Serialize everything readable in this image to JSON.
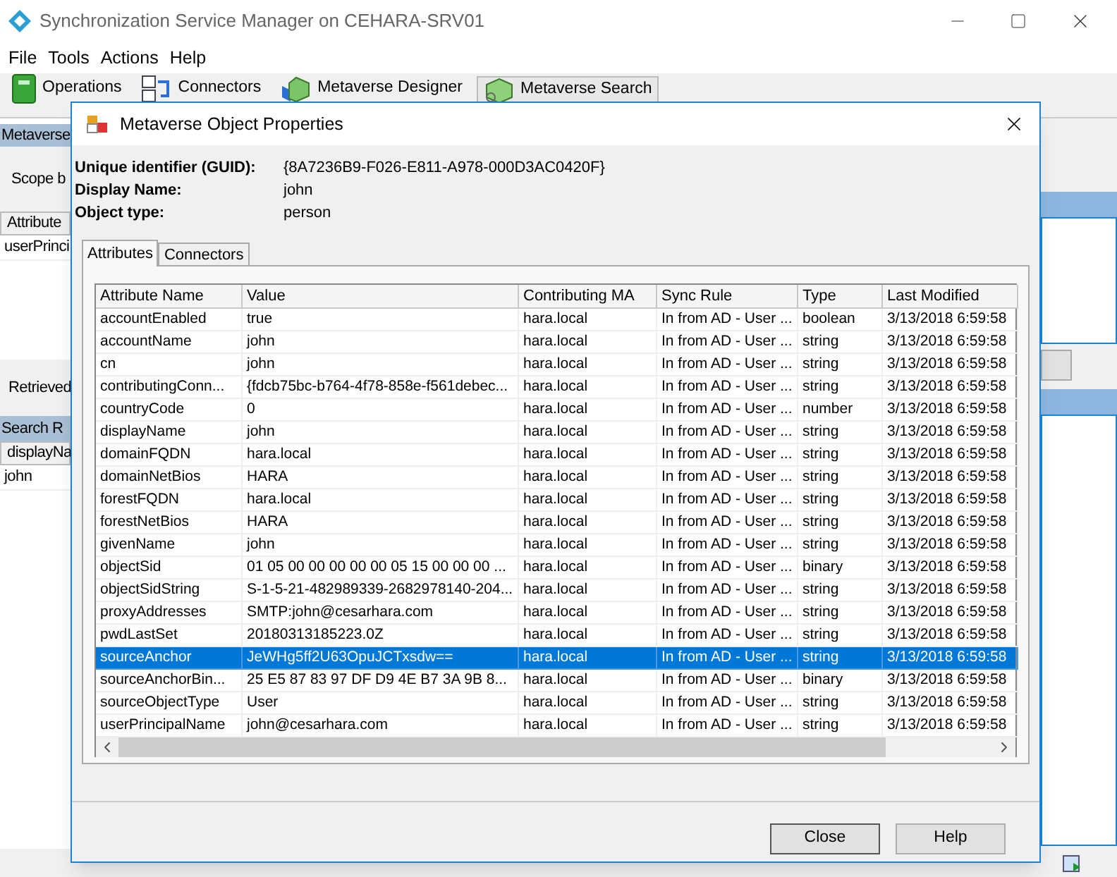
{
  "window": {
    "title": "Synchronization Service Manager on CEHARA-SRV01"
  },
  "menu": [
    "File",
    "Tools",
    "Actions",
    "Help"
  ],
  "toolbar": [
    {
      "label": "Operations",
      "selected": false
    },
    {
      "label": "Connectors",
      "selected": false
    },
    {
      "label": "Metaverse Designer",
      "selected": false
    },
    {
      "label": "Metaverse Search",
      "selected": true
    }
  ],
  "left_panel": {
    "header": "Metaverse",
    "scope_label": "Scope b",
    "grid_header": "Attribute",
    "grid_rows": [
      "userPrinci"
    ],
    "retrieved_label": "Retrieved",
    "results_header": "Search R",
    "results_column": "displayNa",
    "results_rows": [
      "john"
    ]
  },
  "dialog": {
    "title": "Metaverse Object Properties",
    "fields": [
      {
        "label": "Unique identifier (GUID):",
        "value": "{8A7236B9-F026-E811-A978-000D3AC0420F}"
      },
      {
        "label": "Display Name:",
        "value": "john"
      },
      {
        "label": "Object type:",
        "value": "person"
      }
    ],
    "tabs": [
      {
        "label": "Attributes",
        "selected": true
      },
      {
        "label": "Connectors",
        "selected": false
      }
    ],
    "table": {
      "columns": [
        "Attribute Name",
        "Value",
        "Contributing MA",
        "Sync Rule",
        "Type",
        "Last Modified"
      ],
      "rows": [
        {
          "name": "accountEnabled",
          "value": "true",
          "ma": "hara.local",
          "rule": "In from AD - User ...",
          "type": "boolean",
          "modified": "3/13/2018 6:59:58",
          "selected": false
        },
        {
          "name": "accountName",
          "value": "john",
          "ma": "hara.local",
          "rule": "In from AD - User ...",
          "type": "string",
          "modified": "3/13/2018 6:59:58",
          "selected": false
        },
        {
          "name": "cn",
          "value": "john",
          "ma": "hara.local",
          "rule": "In from AD - User ...",
          "type": "string",
          "modified": "3/13/2018 6:59:58",
          "selected": false
        },
        {
          "name": "contributingConn...",
          "value": "{fdcb75bc-b764-4f78-858e-f561debec...",
          "ma": "hara.local",
          "rule": "In from AD - User ...",
          "type": "string",
          "modified": "3/13/2018 6:59:58",
          "selected": false
        },
        {
          "name": "countryCode",
          "value": "0",
          "ma": "hara.local",
          "rule": "In from AD - User ...",
          "type": "number",
          "modified": "3/13/2018 6:59:58",
          "selected": false
        },
        {
          "name": "displayName",
          "value": "john",
          "ma": "hara.local",
          "rule": "In from AD - User ...",
          "type": "string",
          "modified": "3/13/2018 6:59:58",
          "selected": false
        },
        {
          "name": "domainFQDN",
          "value": "hara.local",
          "ma": "hara.local",
          "rule": "In from AD - User ...",
          "type": "string",
          "modified": "3/13/2018 6:59:58",
          "selected": false
        },
        {
          "name": "domainNetBios",
          "value": "HARA",
          "ma": "hara.local",
          "rule": "In from AD - User ...",
          "type": "string",
          "modified": "3/13/2018 6:59:58",
          "selected": false
        },
        {
          "name": "forestFQDN",
          "value": "hara.local",
          "ma": "hara.local",
          "rule": "In from AD - User ...",
          "type": "string",
          "modified": "3/13/2018 6:59:58",
          "selected": false
        },
        {
          "name": "forestNetBios",
          "value": "HARA",
          "ma": "hara.local",
          "rule": "In from AD - User ...",
          "type": "string",
          "modified": "3/13/2018 6:59:58",
          "selected": false
        },
        {
          "name": "givenName",
          "value": "john",
          "ma": "hara.local",
          "rule": "In from AD - User ...",
          "type": "string",
          "modified": "3/13/2018 6:59:58",
          "selected": false
        },
        {
          "name": "objectSid",
          "value": "01 05 00 00 00 00 00 05 15 00 00 00 ...",
          "ma": "hara.local",
          "rule": "In from AD - User ...",
          "type": "binary",
          "modified": "3/13/2018 6:59:58",
          "selected": false
        },
        {
          "name": "objectSidString",
          "value": "S-1-5-21-482989339-2682978140-204...",
          "ma": "hara.local",
          "rule": "In from AD - User ...",
          "type": "string",
          "modified": "3/13/2018 6:59:58",
          "selected": false
        },
        {
          "name": "proxyAddresses",
          "value": "SMTP:john@cesarhara.com",
          "ma": "hara.local",
          "rule": "In from AD - User ...",
          "type": "string",
          "modified": "3/13/2018 6:59:58",
          "selected": false
        },
        {
          "name": "pwdLastSet",
          "value": "20180313185223.0Z",
          "ma": "hara.local",
          "rule": "In from AD - User ...",
          "type": "string",
          "modified": "3/13/2018 6:59:58",
          "selected": false
        },
        {
          "name": "sourceAnchor",
          "value": "JeWHg5ff2U63OpuJCTxsdw==",
          "ma": "hara.local",
          "rule": "In from AD - User ...",
          "type": "string",
          "modified": "3/13/2018 6:59:58",
          "selected": true
        },
        {
          "name": "sourceAnchorBin...",
          "value": "25 E5 87 83 97 DF D9 4E B7 3A 9B 8...",
          "ma": "hara.local",
          "rule": "In from AD - User ...",
          "type": "binary",
          "modified": "3/13/2018 6:59:58",
          "selected": false
        },
        {
          "name": "sourceObjectType",
          "value": "User",
          "ma": "hara.local",
          "rule": "In from AD - User ...",
          "type": "string",
          "modified": "3/13/2018 6:59:58",
          "selected": false
        },
        {
          "name": "userPrincipalName",
          "value": "john@cesarhara.com",
          "ma": "hara.local",
          "rule": "In from AD - User ...",
          "type": "string",
          "modified": "3/13/2018 6:59:58",
          "selected": false
        }
      ]
    },
    "buttons": [
      "Close",
      "Help"
    ]
  }
}
